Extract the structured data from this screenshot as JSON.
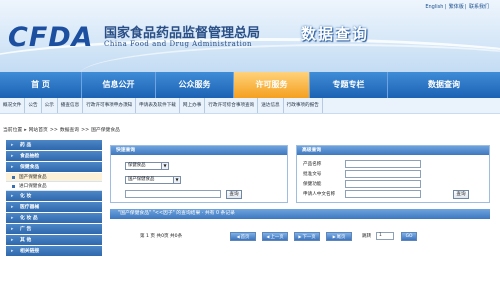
{
  "header": {
    "top_links": [
      "English",
      "繁体版",
      "联系我们"
    ],
    "logo_text": "CFDA",
    "org_name_cn": "国家食品药品监督管理总局",
    "org_name_en": "China Food and Drug Administration",
    "site_title": "数据查询"
  },
  "mainnav": {
    "items": [
      {
        "label": "首    页"
      },
      {
        "label": "信息公开"
      },
      {
        "label": "公众服务"
      },
      {
        "label": "许可服务"
      },
      {
        "label": "专题专栏"
      },
      {
        "label": "数据查询"
      }
    ],
    "active_index": 3
  },
  "subnav": {
    "items": [
      "概况文件",
      "公告",
      "公示",
      "播查信息",
      "行政许可事项申办须知",
      "申请表及软件下载",
      "网上办事",
      "行政许可综合事项查询",
      "送达信息",
      "行政事项的报告"
    ]
  },
  "breadcrumb": {
    "prefix": "当前位置",
    "items": [
      "网站首页",
      "数据查询",
      "国产保健食品"
    ]
  },
  "sidebar": {
    "sections": [
      {
        "label": "药    品",
        "subs": []
      },
      {
        "label": "食品抽检",
        "subs": []
      },
      {
        "label": "保健食品",
        "subs": [
          "国产保健食品",
          "进口保健食品"
        ]
      },
      {
        "label": "化    妆",
        "subs": []
      },
      {
        "label": "医疗器械",
        "subs": []
      },
      {
        "label": "化 妆 品",
        "subs": []
      },
      {
        "label": "广    告",
        "subs": []
      },
      {
        "label": "其    他",
        "subs": []
      },
      {
        "label": "相关链接",
        "subs": []
      }
    ],
    "selected_sub": "国产保健食品"
  },
  "quick_query": {
    "title": "快速查询",
    "select1": "保健食品",
    "select2": "国产保健食品",
    "button": "查询"
  },
  "advanced_query": {
    "title": "高级查询",
    "fields": [
      "产品名称",
      "批准文号",
      "保健功能",
      "申请人中文名称"
    ],
    "button": "查询"
  },
  "result": {
    "text": "\"国产保健食品\" \"<<因子\" 的查询结果  ·  共有 0 条记录"
  },
  "pager": {
    "summary": "第 1 页 共0页 共0条",
    "first": "首页",
    "prev": "上一页",
    "next": "下一页",
    "last": "尾页",
    "jump_label": "跳转",
    "page_value": "1",
    "go": "GO"
  }
}
